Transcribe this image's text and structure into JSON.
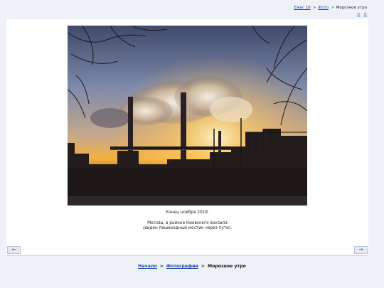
{
  "top_breadcrumb": {
    "items": [
      "Ежег 16",
      "Фото",
      "Морозное утро"
    ],
    "separator": ">"
  },
  "top_nav": {
    "prev": "<",
    "next": ">"
  },
  "caption": {
    "line1": "Конец ноября 2018.",
    "line2": "Москва, в районе Киевского вокзала",
    "line3": "(виден пешеходный мостик через пути)."
  },
  "corner_nav": {
    "left_icon": "prev-arrow-icon",
    "right_icon": "next-arrow-icon"
  },
  "bottom_breadcrumb": {
    "home": "Начало",
    "photos": "Фотографии",
    "current": "Морозное утро",
    "separator": ">"
  },
  "colors": {
    "link": "#1a4aa8",
    "page_background": "#eef2f7",
    "card_background": "#ffffff"
  }
}
